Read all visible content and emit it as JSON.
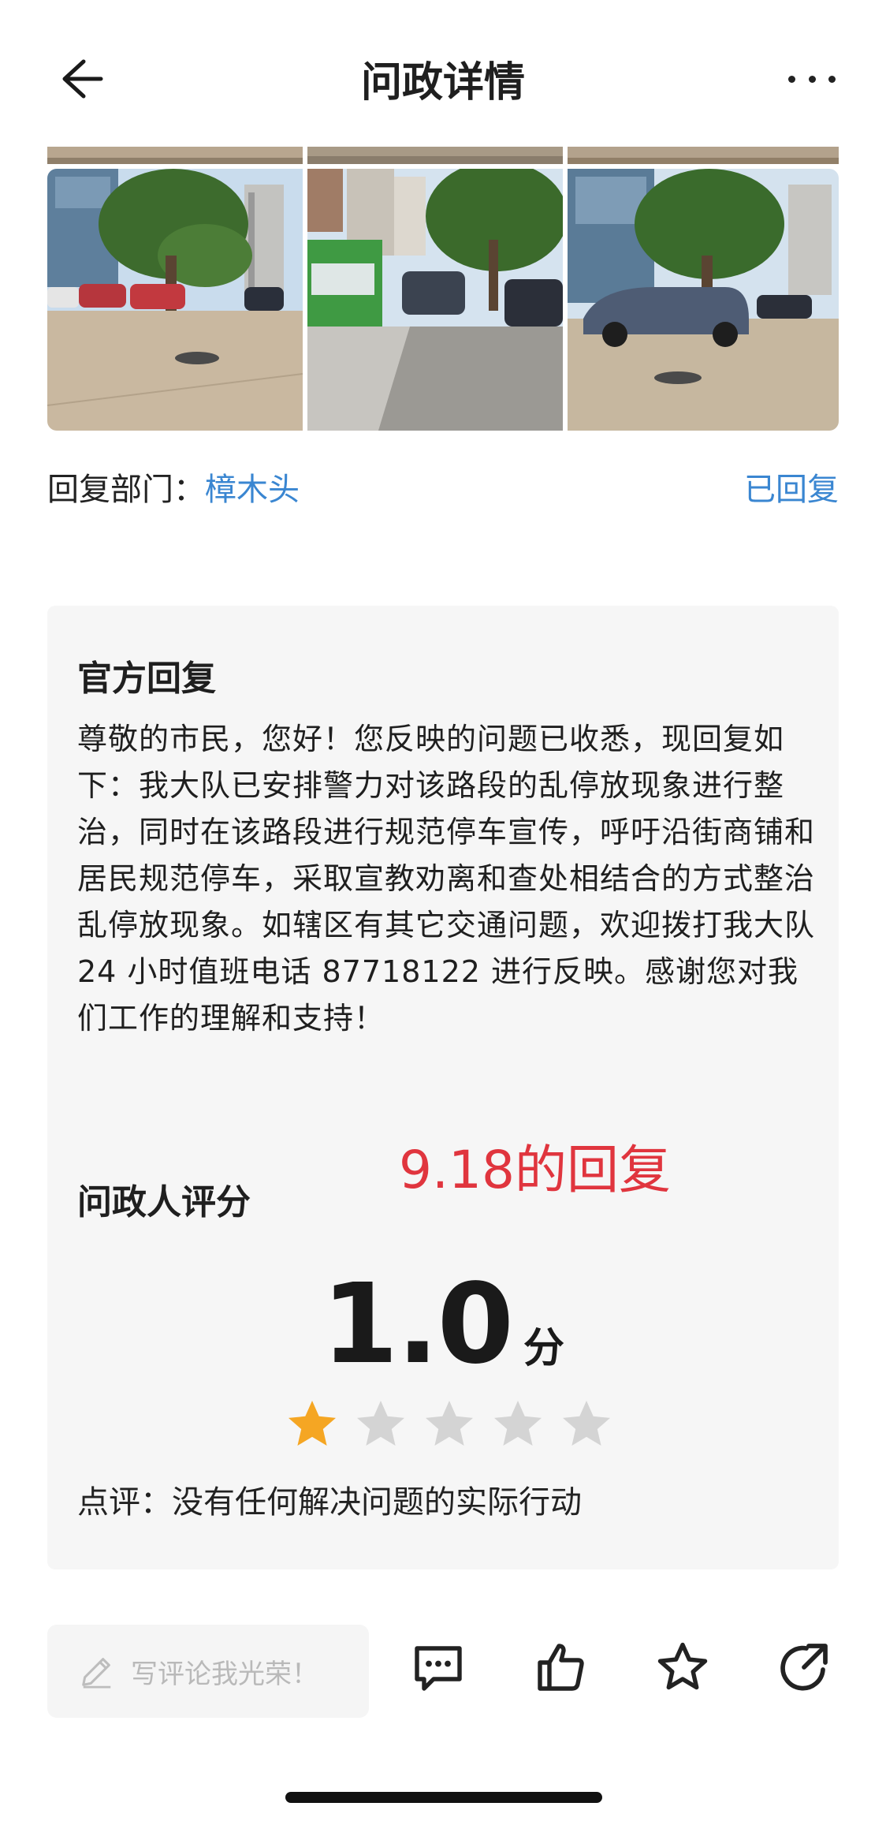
{
  "header": {
    "title": "问政详情",
    "back_icon": "arrow-left-icon",
    "more_icon": "more-horizontal-icon"
  },
  "photos": [
    {
      "icon": "street-photo-1"
    },
    {
      "icon": "street-photo-2"
    },
    {
      "icon": "street-photo-3"
    }
  ],
  "reply_info": {
    "label": "回复部门：",
    "department": "樟木头",
    "status": "已回复"
  },
  "official_reply": {
    "title": "官方回复",
    "text": "尊敬的市民，您好！您反映的问题已收悉，现回复如下：我大队已安排警力对该路段的乱停放现象进行整治，同时在该路段进行规范停车宣传，呼吁沿街商铺和居民规范停车，采取宣教劝离和查处相结合的方式整治乱停放现象。如辖区有其它交通问题，欢迎拨打我大队 24 小时值班电话 87718122 进行反映。感谢您对我们工作的理解和支持！"
  },
  "annotation": {
    "text": "9.18的回复",
    "color": "#e0353e"
  },
  "rating": {
    "title": "问政人评分",
    "score": "1.0",
    "unit": "分",
    "stars_filled": 1,
    "stars_total": 5,
    "star_color": "#f5a623",
    "comment": "点评：没有任何解决问题的实际行动"
  },
  "bottom_bar": {
    "input_placeholder": "写评论我光荣！",
    "actions": [
      "comment-icon",
      "thumbs-up-icon",
      "star-icon",
      "share-icon"
    ]
  },
  "colors": {
    "accent": "#3a86d1",
    "card_bg": "#f6f6f6"
  }
}
